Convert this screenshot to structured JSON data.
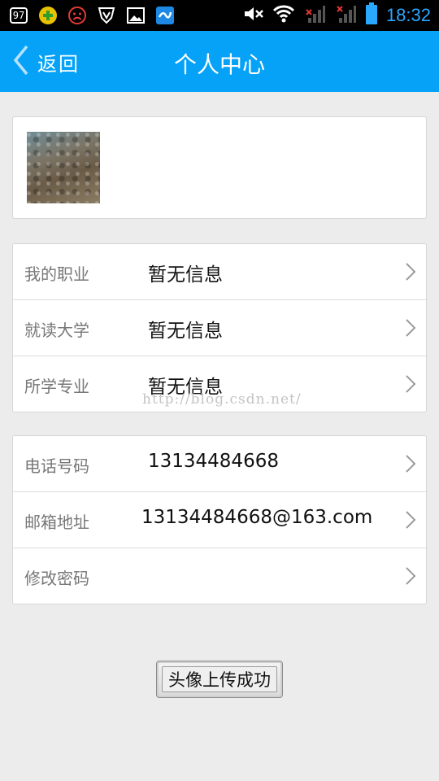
{
  "status_bar": {
    "badge": "97",
    "time": "18:32",
    "icons": [
      "battery-97-icon",
      "plus-circle-icon",
      "sad-face-icon",
      "shield-v-icon",
      "image-icon",
      "app-icon",
      "mute-icon",
      "wifi-icon",
      "signal-icon",
      "signal-icon-2",
      "battery-icon"
    ]
  },
  "header": {
    "back_label": "返回",
    "title": "个人中心"
  },
  "info_rows": [
    {
      "label": "我的职业",
      "value": "暂无信息"
    },
    {
      "label": "就读大学",
      "value": "暂无信息"
    },
    {
      "label": "所学专业",
      "value": "暂无信息"
    }
  ],
  "contact_rows": [
    {
      "label": "电话号码",
      "value": "13134484668"
    },
    {
      "label": "邮箱地址",
      "value": "13134484668@163.com"
    },
    {
      "label": "修改密码",
      "value": ""
    }
  ],
  "watermark": "http://blog.csdn.net/",
  "toast": "头像上传成功",
  "colors": {
    "accent": "#05a2f8",
    "background": "#ececec",
    "time": "#2aa7ff"
  }
}
